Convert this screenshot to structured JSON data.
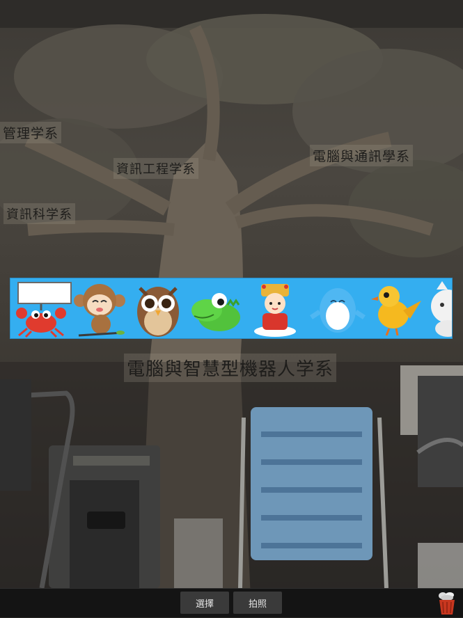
{
  "camera": {
    "signs": [
      "管理学系",
      "資訊工程学系",
      "電腦與通訊學系",
      "資訊科学系",
      "電腦與智慧型機器人学系"
    ]
  },
  "sticker_strip": {
    "background_color": "#34aef0",
    "stickers": [
      "crab-icon",
      "monkey-icon",
      "owl-icon",
      "crocodile-icon",
      "goddess-icon",
      "dolphin-icon",
      "bird-icon",
      "cat-icon"
    ]
  },
  "toolbar": {
    "select_label": "選擇",
    "capture_label": "拍照",
    "trash_icon": "trash-icon"
  }
}
